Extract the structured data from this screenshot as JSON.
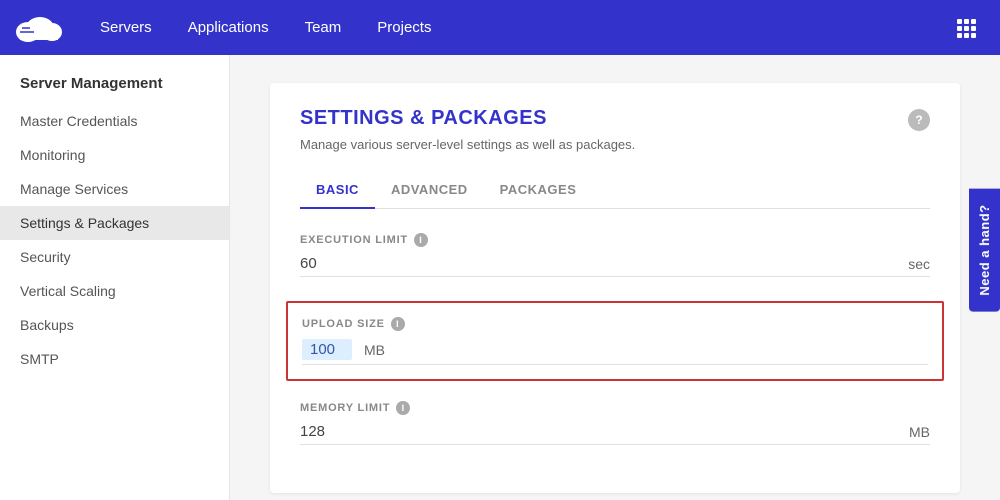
{
  "navbar": {
    "links": [
      {
        "label": "Servers",
        "id": "servers"
      },
      {
        "label": "Applications",
        "id": "applications"
      },
      {
        "label": "Team",
        "id": "team"
      },
      {
        "label": "Projects",
        "id": "projects"
      }
    ]
  },
  "sidebar": {
    "title": "Server Management",
    "items": [
      {
        "label": "Master Credentials",
        "id": "master-credentials",
        "active": false
      },
      {
        "label": "Monitoring",
        "id": "monitoring",
        "active": false
      },
      {
        "label": "Manage Services",
        "id": "manage-services",
        "active": false
      },
      {
        "label": "Settings & Packages",
        "id": "settings-packages",
        "active": true
      },
      {
        "label": "Security",
        "id": "security",
        "active": false
      },
      {
        "label": "Vertical Scaling",
        "id": "vertical-scaling",
        "active": false
      },
      {
        "label": "Backups",
        "id": "backups",
        "active": false
      },
      {
        "label": "SMTP",
        "id": "smtp",
        "active": false
      }
    ]
  },
  "content": {
    "title": "SETTINGS & PACKAGES",
    "subtitle": "Manage various server-level settings as well as packages.",
    "help_label": "?",
    "tabs": [
      {
        "label": "BASIC",
        "id": "basic",
        "active": true
      },
      {
        "label": "ADVANCED",
        "id": "advanced",
        "active": false
      },
      {
        "label": "PACKAGES",
        "id": "packages",
        "active": false
      }
    ],
    "fields": [
      {
        "id": "execution-limit",
        "label": "EXECUTION LIMIT",
        "value": "60",
        "unit": "sec",
        "highlighted": false
      },
      {
        "id": "upload-size",
        "label": "UPLOAD SIZE",
        "value": "100",
        "unit": "MB",
        "highlighted": true
      },
      {
        "id": "memory-limit",
        "label": "MEMORY LIMIT",
        "value": "128",
        "unit": "MB",
        "highlighted": false
      }
    ]
  },
  "need_hand": {
    "label": "Need a hand?"
  }
}
